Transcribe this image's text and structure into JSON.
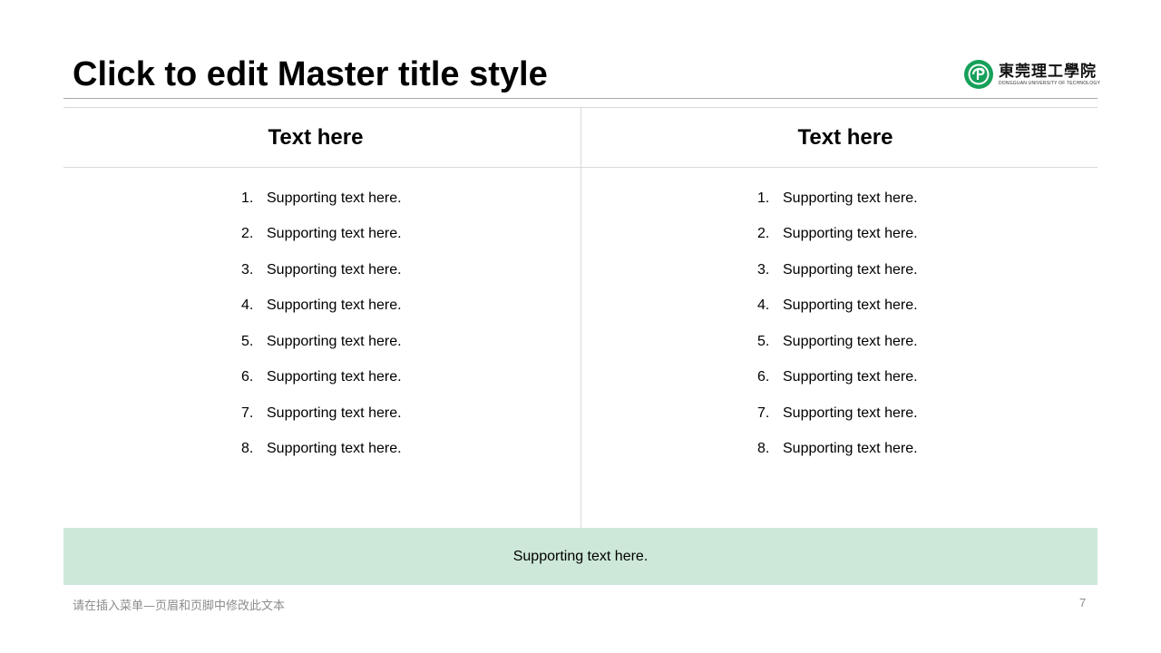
{
  "slide": {
    "title": "Click to edit Master title style",
    "logo": {
      "cn": "東莞理工學院",
      "en": "DONGGUAN UNIVERSITY OF TECHNOLOGY",
      "brand_color": "#16a05a",
      "icon": "university-seal-icon"
    },
    "columns": [
      {
        "header": "Text here",
        "items": [
          {
            "num": "1.",
            "text": "Supporting text here."
          },
          {
            "num": "2.",
            "text": "Supporting text here."
          },
          {
            "num": "3.",
            "text": "Supporting text here."
          },
          {
            "num": "4.",
            "text": "Supporting text here."
          },
          {
            "num": "5.",
            "text": "Supporting text here."
          },
          {
            "num": "6.",
            "text": "Supporting text here."
          },
          {
            "num": "7.",
            "text": "Supporting text here."
          },
          {
            "num": "8.",
            "text": "Supporting text here."
          }
        ]
      },
      {
        "header": "Text here",
        "items": [
          {
            "num": "1.",
            "text": "Supporting text here."
          },
          {
            "num": "2.",
            "text": "Supporting text here."
          },
          {
            "num": "3.",
            "text": "Supporting text here."
          },
          {
            "num": "4.",
            "text": "Supporting text here."
          },
          {
            "num": "5.",
            "text": "Supporting text here."
          },
          {
            "num": "6.",
            "text": "Supporting text here."
          },
          {
            "num": "7.",
            "text": "Supporting text here."
          },
          {
            "num": "8.",
            "text": "Supporting text here."
          }
        ]
      }
    ],
    "band_text": "Supporting text here.",
    "band_color": "#cde8d9",
    "footer_note": "请在插入菜单—页眉和页脚中修改此文本",
    "page_number": "7"
  }
}
